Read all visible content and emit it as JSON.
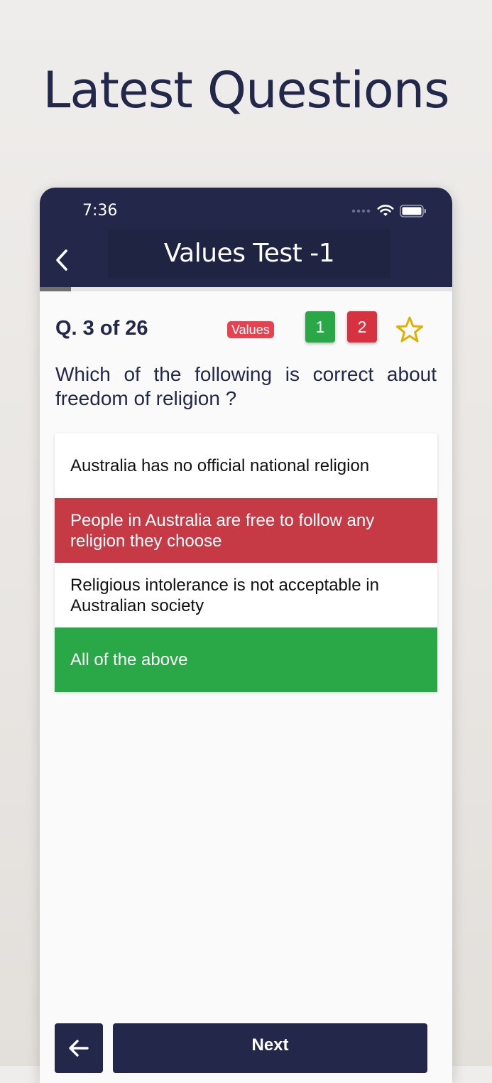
{
  "headline": "Latest Questions",
  "status_bar": {
    "time": "7:36"
  },
  "nav": {
    "title": "Values Test -1"
  },
  "progress": {
    "fraction": 0.075
  },
  "question_header": {
    "counter": "Q. 3 of 26",
    "category": "Values",
    "correct_count": "1",
    "wrong_count": "2"
  },
  "question": {
    "text": "Which of the following is correct about freedom of religion ?",
    "options": [
      {
        "label": "Australia has no official national religion",
        "state": "normal"
      },
      {
        "label": "People in Australia are free to follow any religion they choose",
        "state": "wrong"
      },
      {
        "label": "Religious intolerance is not acceptable in Australian society",
        "state": "normal"
      },
      {
        "label": "All of the above",
        "state": "correct"
      }
    ]
  },
  "footer": {
    "next_label": "Next"
  },
  "colors": {
    "navy": "#23284a",
    "correct": "#2aa847",
    "wrong": "#c63a45",
    "badge": "#e8414f",
    "star": "#e0b000"
  },
  "icons": [
    "back-chevron-icon",
    "wifi-icon",
    "battery-icon",
    "signal-dots-icon",
    "star-icon",
    "arrow-left-icon"
  ]
}
